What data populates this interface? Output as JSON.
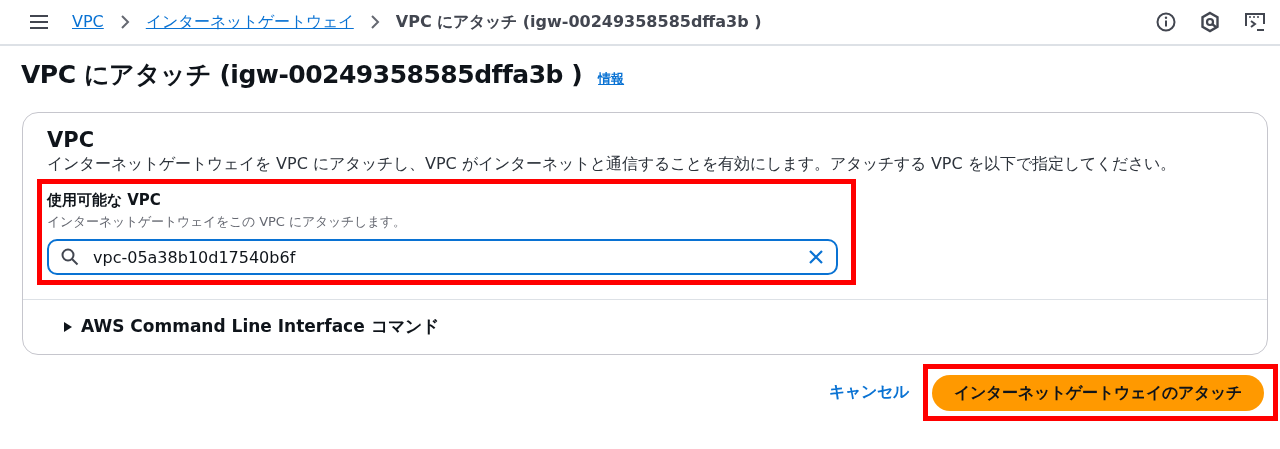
{
  "breadcrumbs": [
    {
      "label": "VPC",
      "link": true
    },
    {
      "label": "インターネットゲートウェイ",
      "link": true
    },
    {
      "label": "VPC にアタッチ (igw-00249358585dffa3b )",
      "link": false
    }
  ],
  "page": {
    "title": "VPC にアタッチ (igw-00249358585dffa3b )",
    "info_link": "情報"
  },
  "card": {
    "heading": "VPC",
    "description": "インターネットゲートウェイを VPC にアタッチし、VPC がインターネットと通信することを有効にします。アタッチする VPC を以下で指定してください。",
    "field": {
      "label": "使用可能な VPC",
      "hint": "インターネットゲートウェイをこの VPC にアタッチします。",
      "value": "vpc-05a38b10d17540b6f",
      "highlighted": true
    },
    "expander": {
      "label": "AWS Command Line Interface コマンド",
      "expanded": false
    }
  },
  "actions": {
    "cancel": "キャンセル",
    "submit": {
      "label": "インターネットゲートウェイのアタッチ",
      "highlighted": true
    }
  }
}
